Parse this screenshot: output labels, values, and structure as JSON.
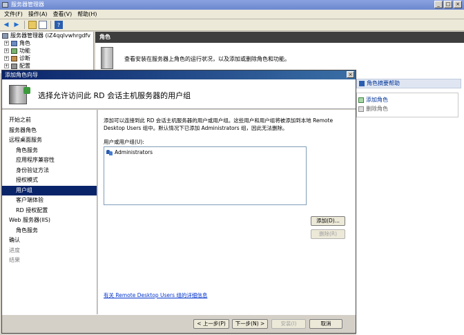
{
  "window": {
    "title": "服务器管理器"
  },
  "menu": [
    "文件(F)",
    "操作(A)",
    "查看(V)",
    "帮助(H)"
  ],
  "tree": {
    "root": "服务器管理器 (iZ4qqlvwhrgdfv",
    "items": [
      "角色",
      "功能",
      "诊断",
      "配置"
    ]
  },
  "roles_panel": {
    "header": "角色",
    "description": "查看安装在服务器上角色的运行状况，以及添加或删除角色和功能。"
  },
  "help_panel": {
    "title": "角色摘要帮助",
    "links": [
      "添加角色",
      "删除角色"
    ]
  },
  "wizard": {
    "title": "添加角色向导",
    "heading": "选择允许访问此 RD 会话主机服务器的用户组",
    "steps": [
      {
        "label": "开始之前",
        "level": 0,
        "state": "normal"
      },
      {
        "label": "服务器角色",
        "level": 0,
        "state": "normal"
      },
      {
        "label": "远程桌面服务",
        "level": 0,
        "state": "normal"
      },
      {
        "label": "角色服务",
        "level": 1,
        "state": "normal"
      },
      {
        "label": "应用程序兼容性",
        "level": 1,
        "state": "normal"
      },
      {
        "label": "身份验证方法",
        "level": 1,
        "state": "normal"
      },
      {
        "label": "授权模式",
        "level": 1,
        "state": "normal"
      },
      {
        "label": "用户组",
        "level": 1,
        "state": "active"
      },
      {
        "label": "客户端体验",
        "level": 1,
        "state": "normal"
      },
      {
        "label": "RD 授权配置",
        "level": 1,
        "state": "normal"
      },
      {
        "label": "Web 服务器(IIS)",
        "level": 0,
        "state": "normal"
      },
      {
        "label": "角色服务",
        "level": 1,
        "state": "normal"
      },
      {
        "label": "确认",
        "level": 0,
        "state": "normal"
      },
      {
        "label": "进度",
        "level": 0,
        "state": "dim"
      },
      {
        "label": "结果",
        "level": 0,
        "state": "dim"
      }
    ],
    "intro": "添加可以连接到此 RD 会话主机服务器的用户或用户组。这些用户和用户组将被添加到本地 Remote Desktop Users 组中。默认情况下已添加 Administrators 组，因此无法删除。",
    "list_label": "用户或用户组(U):",
    "list_items": [
      "Administrators"
    ],
    "add_button": "添加(D)...",
    "remove_button": "删除(R)",
    "detail_link": "有关 Remote Desktop Users 组的详细信息",
    "back_button": "< 上一步(P)",
    "next_button": "下一步(N) >",
    "install_button": "安装(I)",
    "cancel_button": "取消"
  }
}
